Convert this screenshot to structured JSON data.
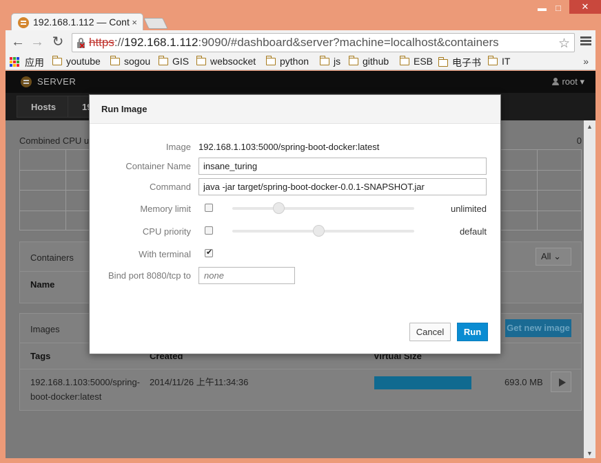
{
  "browser": {
    "tab_title": "192.168.1.112 — Cont",
    "tab_close": "×",
    "url_proto": "https",
    "url_sep": "://",
    "url_host": "192.168.1.112",
    "url_rest": ":9090/#dashboard&server?machine=localhost&containers",
    "window_controls": {
      "min": "▬",
      "max": "□",
      "close": "✕"
    },
    "bookmarks": [
      "应用",
      "youtube",
      "sogou",
      "GIS",
      "websocket",
      "python",
      "js",
      "github",
      "ESB",
      "电子书",
      "IT"
    ],
    "bookmarks_more": "»"
  },
  "app": {
    "name": "SERVER",
    "user": "root",
    "nav_tabs": [
      "Hosts",
      "19"
    ],
    "cpu_label": "Combined CPU us",
    "cpu_value": "0",
    "containers": {
      "title": "Containers",
      "column_name": "Name",
      "filter_value": "All"
    },
    "images": {
      "title": "Images",
      "get_new_image": "Get new image",
      "columns": [
        "Tags",
        "Created",
        "Virtual Size"
      ],
      "rows": [
        {
          "tag_line1": "192.168.1.103:5000/spring-",
          "tag_line2": "boot-docker:latest",
          "created": "2014/11/26 上午11:34:36",
          "size": "693.0 MB"
        }
      ]
    }
  },
  "modal": {
    "title": "Run Image",
    "image_label": "Image",
    "image_value": "192.168.1.103:5000/spring-boot-docker:latest",
    "container_name_label": "Container Name",
    "container_name_value": "insane_turing",
    "command_label": "Command",
    "command_value": "java -jar target/spring-boot-docker-0.0.1-SNAPSHOT.jar",
    "memory_label": "Memory limit",
    "memory_value": "unlimited",
    "memory_checked": false,
    "cpu_label": "CPU priority",
    "cpu_value": "default",
    "cpu_checked": false,
    "terminal_label": "With terminal",
    "terminal_checked": true,
    "port_label": "Bind port 8080/tcp to",
    "port_placeholder": "none",
    "cancel_label": "Cancel",
    "run_label": "Run"
  }
}
